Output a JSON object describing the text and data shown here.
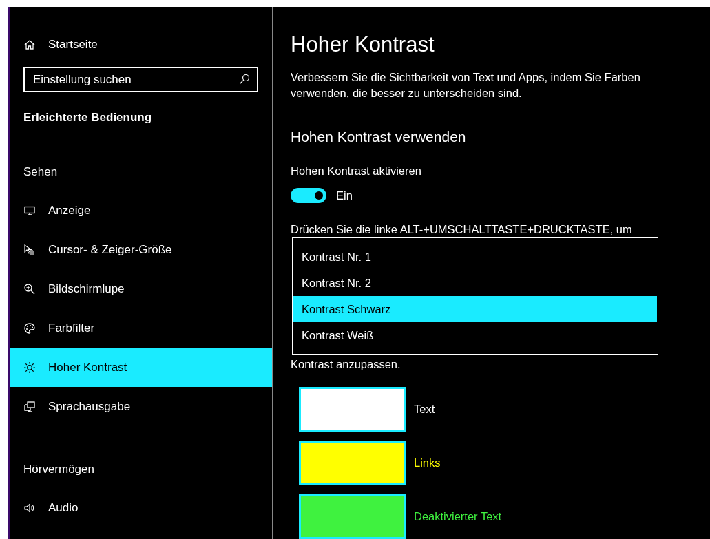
{
  "sidebar": {
    "home": {
      "label": "Startseite"
    },
    "search": {
      "placeholder": "Einstellung suchen"
    },
    "category": "Erleichterte Bedienung",
    "sections": [
      {
        "title": "Sehen",
        "items": [
          {
            "label": "Anzeige",
            "kind": "display",
            "selected": false
          },
          {
            "label": "Cursor- & Zeiger-Größe",
            "kind": "cursor",
            "selected": false
          },
          {
            "label": "Bildschirmlupe",
            "kind": "magnifier",
            "selected": false
          },
          {
            "label": "Farbfilter",
            "kind": "palette",
            "selected": false
          },
          {
            "label": "Hoher Kontrast",
            "kind": "sun",
            "selected": true
          },
          {
            "label": "Sprachausgabe",
            "kind": "narrator",
            "selected": false
          }
        ]
      },
      {
        "title": "Hörvermögen",
        "items": [
          {
            "label": "Audio",
            "kind": "speaker",
            "selected": false
          }
        ]
      }
    ]
  },
  "main": {
    "title": "Hoher Kontrast",
    "description": "Verbessern Sie die Sichtbarkeit von Text und Apps, indem Sie Farben verwenden, die besser zu unterscheiden sind.",
    "section_title": "Hohen Kontrast verwenden",
    "toggle": {
      "label": "Hohen Kontrast aktivieren",
      "on": true,
      "state_text": "Ein"
    },
    "shortcut_hint": "Drücken Sie die linke ALT-+UMSCHALTTASTE+DRUCKTASTE, um",
    "theme_dropdown": {
      "options": [
        {
          "label": "Kontrast Nr. 1",
          "selected": false
        },
        {
          "label": "Kontrast Nr. 2",
          "selected": false
        },
        {
          "label": "Kontrast Schwarz",
          "selected": true
        },
        {
          "label": "Kontrast Weiß",
          "selected": false
        }
      ]
    },
    "swatch_hint": "Kontrast anzupassen.",
    "swatches": [
      {
        "label": "Text",
        "color": "#ffffff"
      },
      {
        "label": "Links",
        "color": "#ffff00"
      },
      {
        "label": "Deaktivierter Text",
        "color": "#3ff23f"
      }
    ]
  }
}
